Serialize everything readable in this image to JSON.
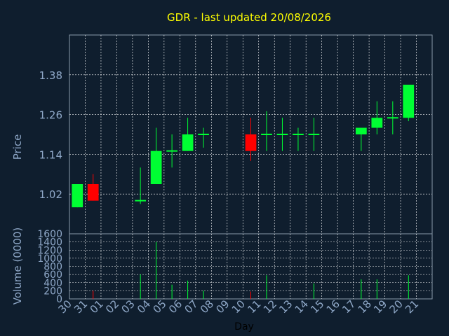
{
  "title": "GDR - last updated 20/08/2026",
  "colors": {
    "background": "#0f1e2e",
    "plot_border": "#8899aa",
    "grid": "#ffffff",
    "title": "#ffff00",
    "axis_text": "#8fa8c8",
    "up": "#00ff33",
    "down": "#ff0000"
  },
  "chart_data": [
    {
      "type": "candlestick",
      "ylabel": "Price",
      "y_ticks": [
        "1.02",
        "1.14",
        "1.26",
        "1.38"
      ],
      "ylim": [
        0.9,
        1.5
      ],
      "grid": true,
      "candles": [
        {
          "day": "30",
          "open": 0.98,
          "high": 1.05,
          "low": 0.98,
          "close": 1.05
        },
        {
          "day": "31",
          "open": 1.05,
          "high": 1.08,
          "low": 1.0,
          "close": 1.0
        },
        {
          "day": "03",
          "open": 1.0,
          "high": 1.1,
          "low": 0.99,
          "close": 1.0
        },
        {
          "day": "04",
          "open": 1.05,
          "high": 1.22,
          "low": 1.05,
          "close": 1.15
        },
        {
          "day": "05",
          "open": 1.15,
          "high": 1.2,
          "low": 1.1,
          "close": 1.15
        },
        {
          "day": "06",
          "open": 1.15,
          "high": 1.25,
          "low": 1.15,
          "close": 1.2
        },
        {
          "day": "07",
          "open": 1.2,
          "high": 1.22,
          "low": 1.16,
          "close": 1.2
        },
        {
          "day": "10",
          "open": 1.2,
          "high": 1.25,
          "low": 1.12,
          "close": 1.15
        },
        {
          "day": "11",
          "open": 1.2,
          "high": 1.27,
          "low": 1.15,
          "close": 1.2
        },
        {
          "day": "12",
          "open": 1.2,
          "high": 1.25,
          "low": 1.15,
          "close": 1.2
        },
        {
          "day": "13",
          "open": 1.2,
          "high": 1.22,
          "low": 1.15,
          "close": 1.2
        },
        {
          "day": "14",
          "open": 1.2,
          "high": 1.25,
          "low": 1.15,
          "close": 1.2
        },
        {
          "day": "17",
          "open": 1.2,
          "high": 1.22,
          "low": 1.15,
          "close": 1.22
        },
        {
          "day": "18",
          "open": 1.22,
          "high": 1.3,
          "low": 1.2,
          "close": 1.25
        },
        {
          "day": "19",
          "open": 1.25,
          "high": 1.3,
          "low": 1.2,
          "close": 1.25
        },
        {
          "day": "20",
          "open": 1.25,
          "high": 1.35,
          "low": 1.24,
          "close": 1.35
        }
      ]
    },
    {
      "type": "bar",
      "ylabel": "Volume (0000)",
      "xlabel": "Day",
      "y_ticks": [
        "0",
        "200",
        "400",
        "600",
        "800",
        "1000",
        "1200",
        "1400",
        "1600"
      ],
      "ylim": [
        0,
        1600
      ],
      "grid": true,
      "categories": [
        "30",
        "31",
        "01",
        "02",
        "03",
        "04",
        "05",
        "06",
        "07",
        "08",
        "09",
        "10",
        "11",
        "12",
        "13",
        "14",
        "15",
        "16",
        "17",
        "18",
        "19",
        "20",
        "21"
      ],
      "bars": [
        {
          "day": "31",
          "value": 200,
          "direction": "down"
        },
        {
          "day": "03",
          "value": 600,
          "direction": "up"
        },
        {
          "day": "04",
          "value": 1400,
          "direction": "up"
        },
        {
          "day": "05",
          "value": 350,
          "direction": "up"
        },
        {
          "day": "06",
          "value": 450,
          "direction": "up"
        },
        {
          "day": "07",
          "value": 200,
          "direction": "up"
        },
        {
          "day": "10",
          "value": 180,
          "direction": "down"
        },
        {
          "day": "11",
          "value": 580,
          "direction": "up"
        },
        {
          "day": "14",
          "value": 380,
          "direction": "up"
        },
        {
          "day": "17",
          "value": 480,
          "direction": "up"
        },
        {
          "day": "18",
          "value": 480,
          "direction": "up"
        },
        {
          "day": "20",
          "value": 580,
          "direction": "up"
        }
      ]
    }
  ]
}
